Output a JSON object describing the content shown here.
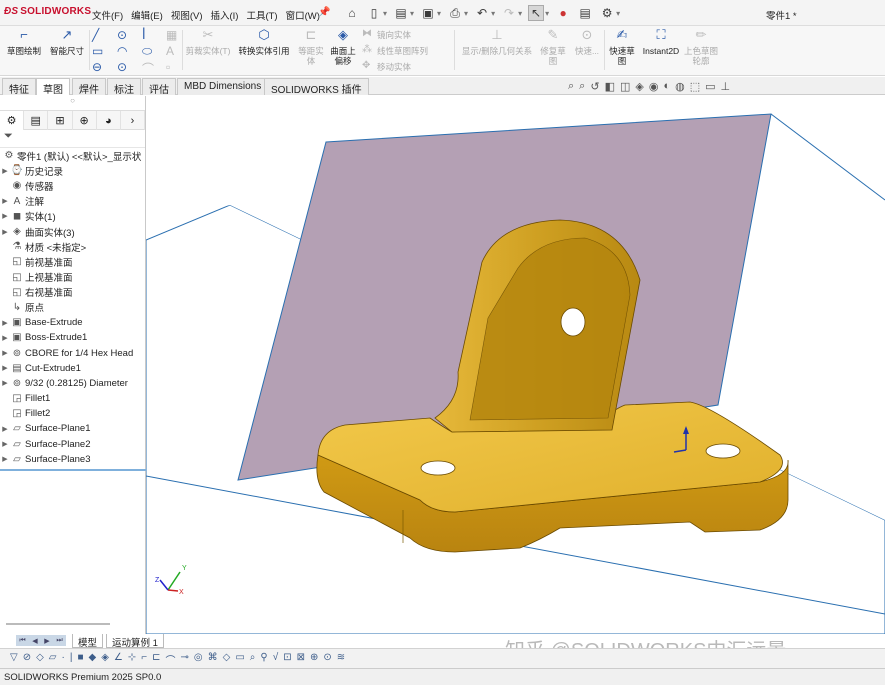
{
  "app": {
    "brand": "SOLIDWORKS",
    "doc_title": "零件1 *",
    "menus": [
      "文件(F)",
      "编辑(E)",
      "视图(V)",
      "插入(I)",
      "工具(T)",
      "窗口(W)"
    ]
  },
  "toolbar": {
    "sketch": "草图绘制",
    "smart_dim": "智能尺寸",
    "trim": "剪裁实体(T)",
    "convert": "转换实体引用",
    "offset_entities": "等距实体",
    "offset_surface_1": "曲面上",
    "offset_surface_2": "偏移",
    "mirror": "镜向实体",
    "linear_pattern": "线性草图阵列",
    "move": "移动实体",
    "relations": "显示/删除几何关系",
    "repair": "修复草图",
    "quick": "快速...",
    "rapid_1": "快速草",
    "rapid_2": "图",
    "instant2d": "Instant2D",
    "shade": "上色草图轮廓"
  },
  "tabs": [
    "特征",
    "草图",
    "焊件",
    "标注",
    "评估",
    "MBD Dimensions",
    "SOLIDWORKS 插件"
  ],
  "active_tab": "草图",
  "tree": {
    "root": "零件1 (默认) <<默认>_显示状",
    "items": [
      {
        "label": "历史记录",
        "icon": "history-icon",
        "exp": true
      },
      {
        "label": "传感器",
        "icon": "sensor-icon",
        "exp": false
      },
      {
        "label": "注解",
        "icon": "annotation-icon",
        "exp": true
      },
      {
        "label": "实体(1)",
        "icon": "solid-body-icon",
        "exp": true
      },
      {
        "label": "曲面实体(3)",
        "icon": "surface-body-icon",
        "exp": true
      },
      {
        "label": "材质 <未指定>",
        "icon": "material-icon",
        "exp": false
      },
      {
        "label": "前视基准面",
        "icon": "plane-icon",
        "exp": false
      },
      {
        "label": "上视基准面",
        "icon": "plane-icon",
        "exp": false
      },
      {
        "label": "右视基准面",
        "icon": "plane-icon",
        "exp": false
      },
      {
        "label": "原点",
        "icon": "origin-icon",
        "exp": false
      },
      {
        "label": "Base-Extrude",
        "icon": "extrude-icon",
        "exp": true
      },
      {
        "label": "Boss-Extrude1",
        "icon": "extrude-icon",
        "exp": true
      },
      {
        "label": "CBORE for 1/4 Hex Head",
        "icon": "hole-icon",
        "exp": true
      },
      {
        "label": "Cut-Extrude1",
        "icon": "cut-icon",
        "exp": true
      },
      {
        "label": "9/32 (0.28125) Diameter",
        "icon": "hole-icon",
        "exp": true
      },
      {
        "label": "Fillet1",
        "icon": "fillet-icon",
        "exp": false
      },
      {
        "label": "Fillet2",
        "icon": "fillet-icon",
        "exp": false
      },
      {
        "label": "Surface-Plane1",
        "icon": "surface-plane-icon",
        "exp": true
      },
      {
        "label": "Surface-Plane2",
        "icon": "surface-plane-icon",
        "exp": true
      },
      {
        "label": "Surface-Plane3",
        "icon": "surface-plane-icon",
        "exp": true
      }
    ]
  },
  "bottom_tabs": [
    "模型",
    "运动算例 1"
  ],
  "status": "SOLIDWORKS Premium 2025 SP0.0",
  "watermark": "知乎 @SOLIDWORKS中汇远景",
  "triad": {
    "x": "X",
    "y": "Y",
    "z": "Z"
  },
  "colors": {
    "part": "#e4b020",
    "plane": "#b4a0b4",
    "edge": "#2a6fb0",
    "accent": "#c8102e"
  }
}
